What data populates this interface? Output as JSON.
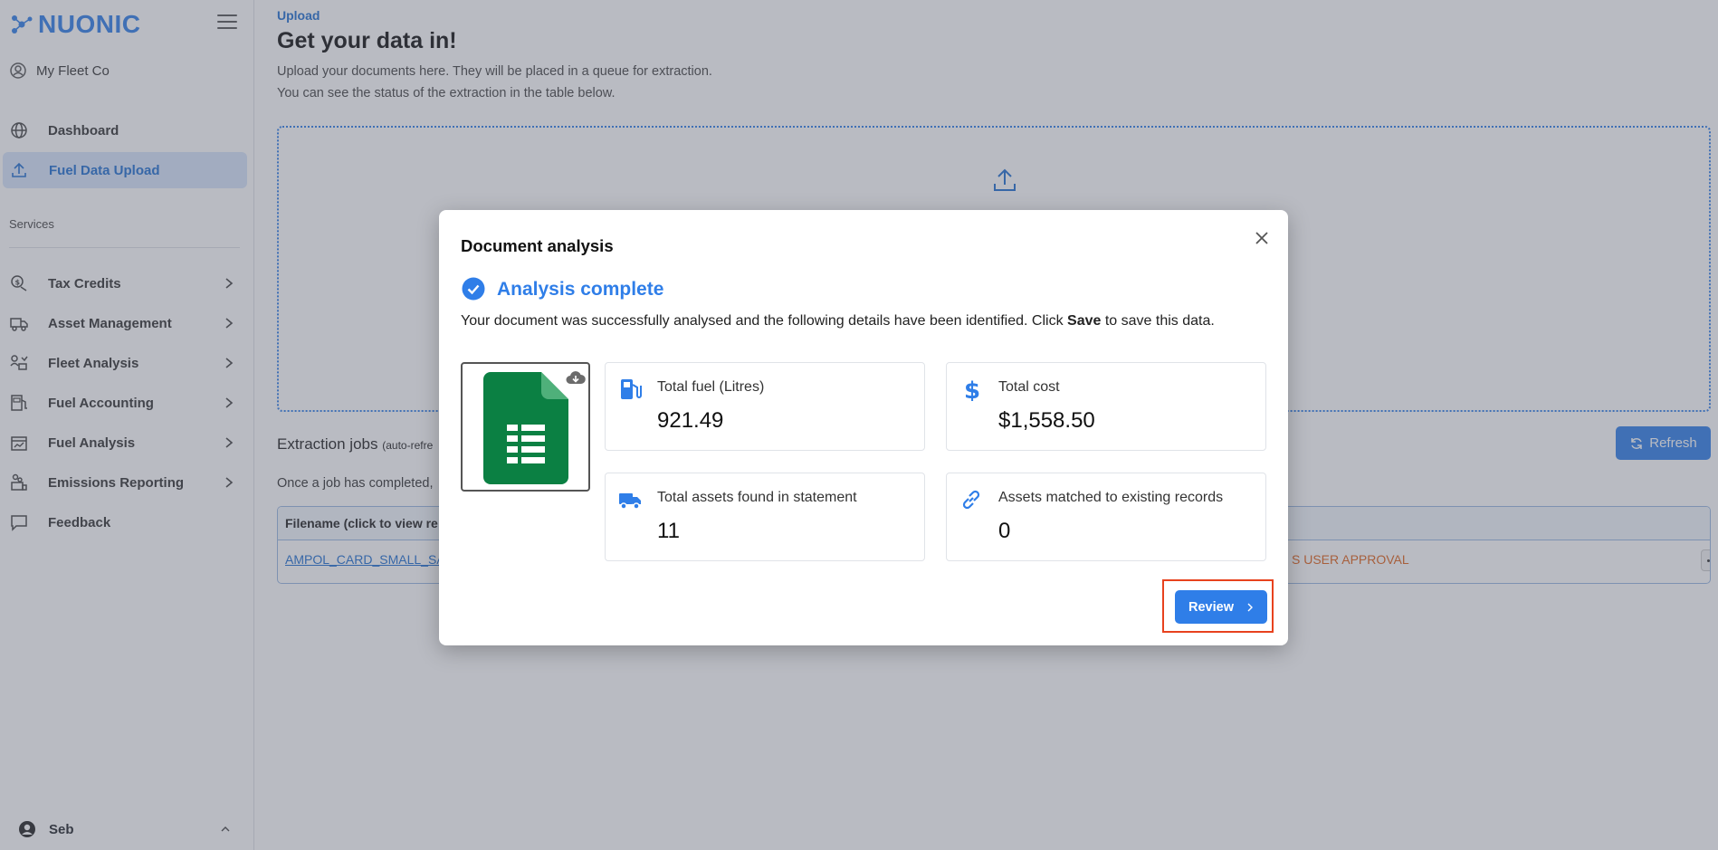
{
  "brand": {
    "name": "NUONIC",
    "accent": "#2f7ee8"
  },
  "org": {
    "name": "My Fleet Co"
  },
  "nav": {
    "dashboard": "Dashboard",
    "fuel_upload": "Fuel Data Upload",
    "services_label": "Services",
    "services": [
      {
        "label": "Tax Credits",
        "icon": "tax-credits-icon"
      },
      {
        "label": "Asset Management",
        "icon": "truck-icon"
      },
      {
        "label": "Fleet Analysis",
        "icon": "fleet-analysis-icon"
      },
      {
        "label": "Fuel Accounting",
        "icon": "fuel-accounting-icon"
      },
      {
        "label": "Fuel Analysis",
        "icon": "fuel-analysis-icon"
      },
      {
        "label": "Emissions Reporting",
        "icon": "emissions-icon"
      }
    ],
    "feedback": "Feedback"
  },
  "user": {
    "name": "Seb"
  },
  "page": {
    "breadcrumb": "Upload",
    "title": "Get your data in!",
    "subtitle_1": "Upload your documents here. They will be placed in a queue for extraction.",
    "subtitle_2": "You can see the status of the extraction in the table below."
  },
  "jobs": {
    "title": "Extraction jobs",
    "title_note": "(auto-refre",
    "note": "Once a job has completed,",
    "refresh_label": "Refresh",
    "column_filename": "Filename (click to view re",
    "rows": [
      {
        "filename": "AMPOL_CARD_SMALL_SA",
        "status": "S USER APPROVAL"
      }
    ]
  },
  "modal": {
    "title": "Document analysis",
    "status": "Analysis complete",
    "desc_before": "Your document was successfully analysed and the following details have been identified. Click ",
    "desc_bold": "Save",
    "desc_after": " to save this data.",
    "stats": [
      {
        "label": "Total fuel (Litres)",
        "value": "921.49",
        "icon": "fuel-pump-icon"
      },
      {
        "label": "Total cost",
        "value": "$1,558.50",
        "icon": "dollar-icon"
      },
      {
        "label": "Total assets found in statement",
        "value": "11",
        "icon": "truck-icon"
      },
      {
        "label": "Assets matched to existing records",
        "value": "0",
        "icon": "link-icon"
      }
    ],
    "review_label": "Review"
  }
}
